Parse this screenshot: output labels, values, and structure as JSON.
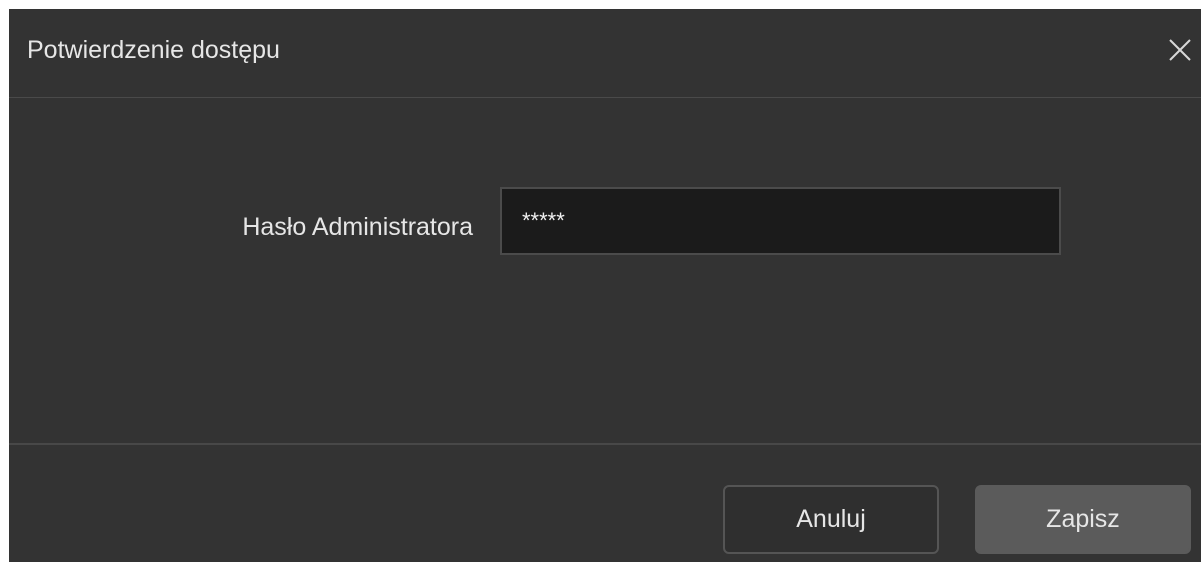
{
  "dialog": {
    "title": "Potwierdzenie dostępu",
    "close_icon": "close-icon"
  },
  "form": {
    "password_label": "Hasło Administratora",
    "password_value": "*****"
  },
  "footer": {
    "cancel_label": "Anuluj",
    "save_label": "Zapisz"
  },
  "colors": {
    "dialog_background": "#333333",
    "input_background": "#1b1b1b",
    "save_button": "#5b5b5b"
  }
}
